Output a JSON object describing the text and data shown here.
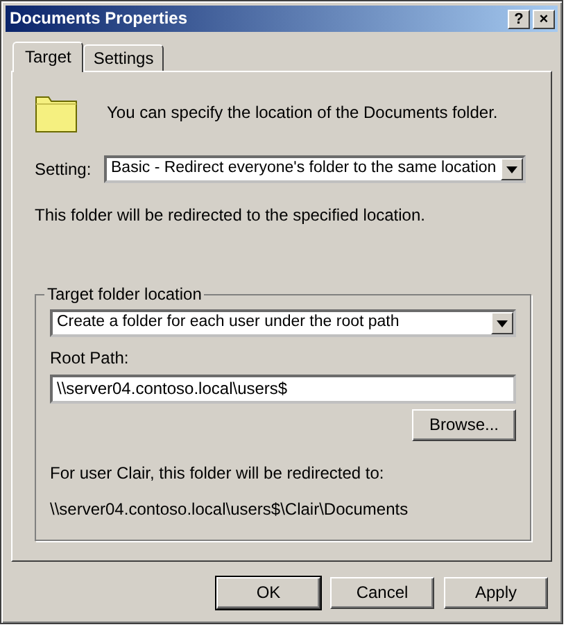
{
  "window": {
    "title": "Documents Properties",
    "title_buttons": [
      "?",
      "×"
    ]
  },
  "tabs": [
    {
      "label": "Target",
      "selected": true
    },
    {
      "label": "Settings",
      "selected": false
    }
  ],
  "intro": "You can specify the location of the Documents folder.",
  "setting": {
    "label": "Setting:",
    "value": "Basic - Redirect everyone's folder to the same location"
  },
  "setting_note": "This folder will be redirected to the specified location.",
  "target_group": {
    "legend": "Target folder location",
    "option": "Create a folder for each user under the root path",
    "root_path_label": "Root Path:",
    "root_path": "\\\\server04.contoso.local\\users$",
    "browse": "Browse...",
    "result_label": "For user Clair, this folder will be redirected to:",
    "result_path": "\\\\server04.contoso.local\\users$\\Clair\\Documents"
  },
  "buttons": [
    {
      "label": "OK",
      "default": true
    },
    {
      "label": "Cancel",
      "default": false
    },
    {
      "label": "Apply",
      "default": false
    }
  ]
}
